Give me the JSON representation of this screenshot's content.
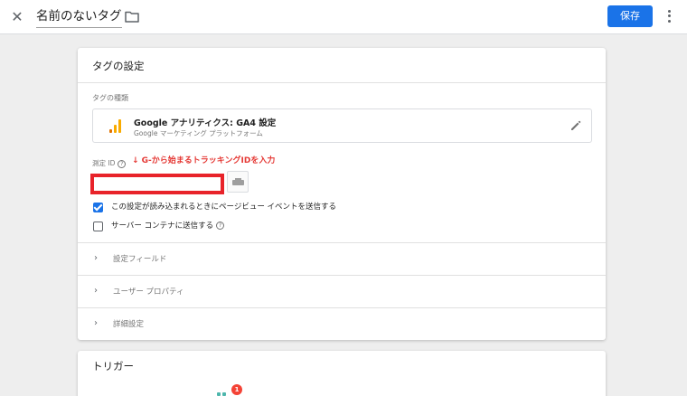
{
  "topbar": {
    "close_icon": "close-icon",
    "tag_name": "名前のないタグ",
    "folder_icon": "folder-icon",
    "save_label": "保存",
    "more_icon": "more-vert-icon"
  },
  "settings": {
    "title": "タグの設定",
    "tag_type_label": "タグの種類",
    "tag_type": {
      "name": "Google アナリティクス: GA4 設定",
      "subtitle": "Google マーケティング プラットフォーム",
      "icon": "google-analytics-icon",
      "edit_icon": "edit-pencil-icon"
    },
    "measurement_id_label": "測定 ID",
    "annotation": "↓ G-から始まるトラッキングIDを入力",
    "measurement_id_value": "",
    "checkboxes": [
      {
        "label": "この設定が読み込まれるときにページビュー イベントを送信する",
        "checked": true
      },
      {
        "label": "サーバー コンテナに送信する",
        "checked": false
      }
    ],
    "expanders": [
      {
        "label": "設定フィールド"
      },
      {
        "label": "ユーザー プロパティ"
      },
      {
        "label": "詳細設定"
      }
    ]
  },
  "trigger": {
    "title": "トリガー",
    "badge_count": "1"
  },
  "colors": {
    "accent": "#1a73e8",
    "highlight_red": "#e8232a",
    "annotation_red": "#e53935",
    "ga_orange": "#f9ab00",
    "ga_dark_orange": "#e37400"
  }
}
